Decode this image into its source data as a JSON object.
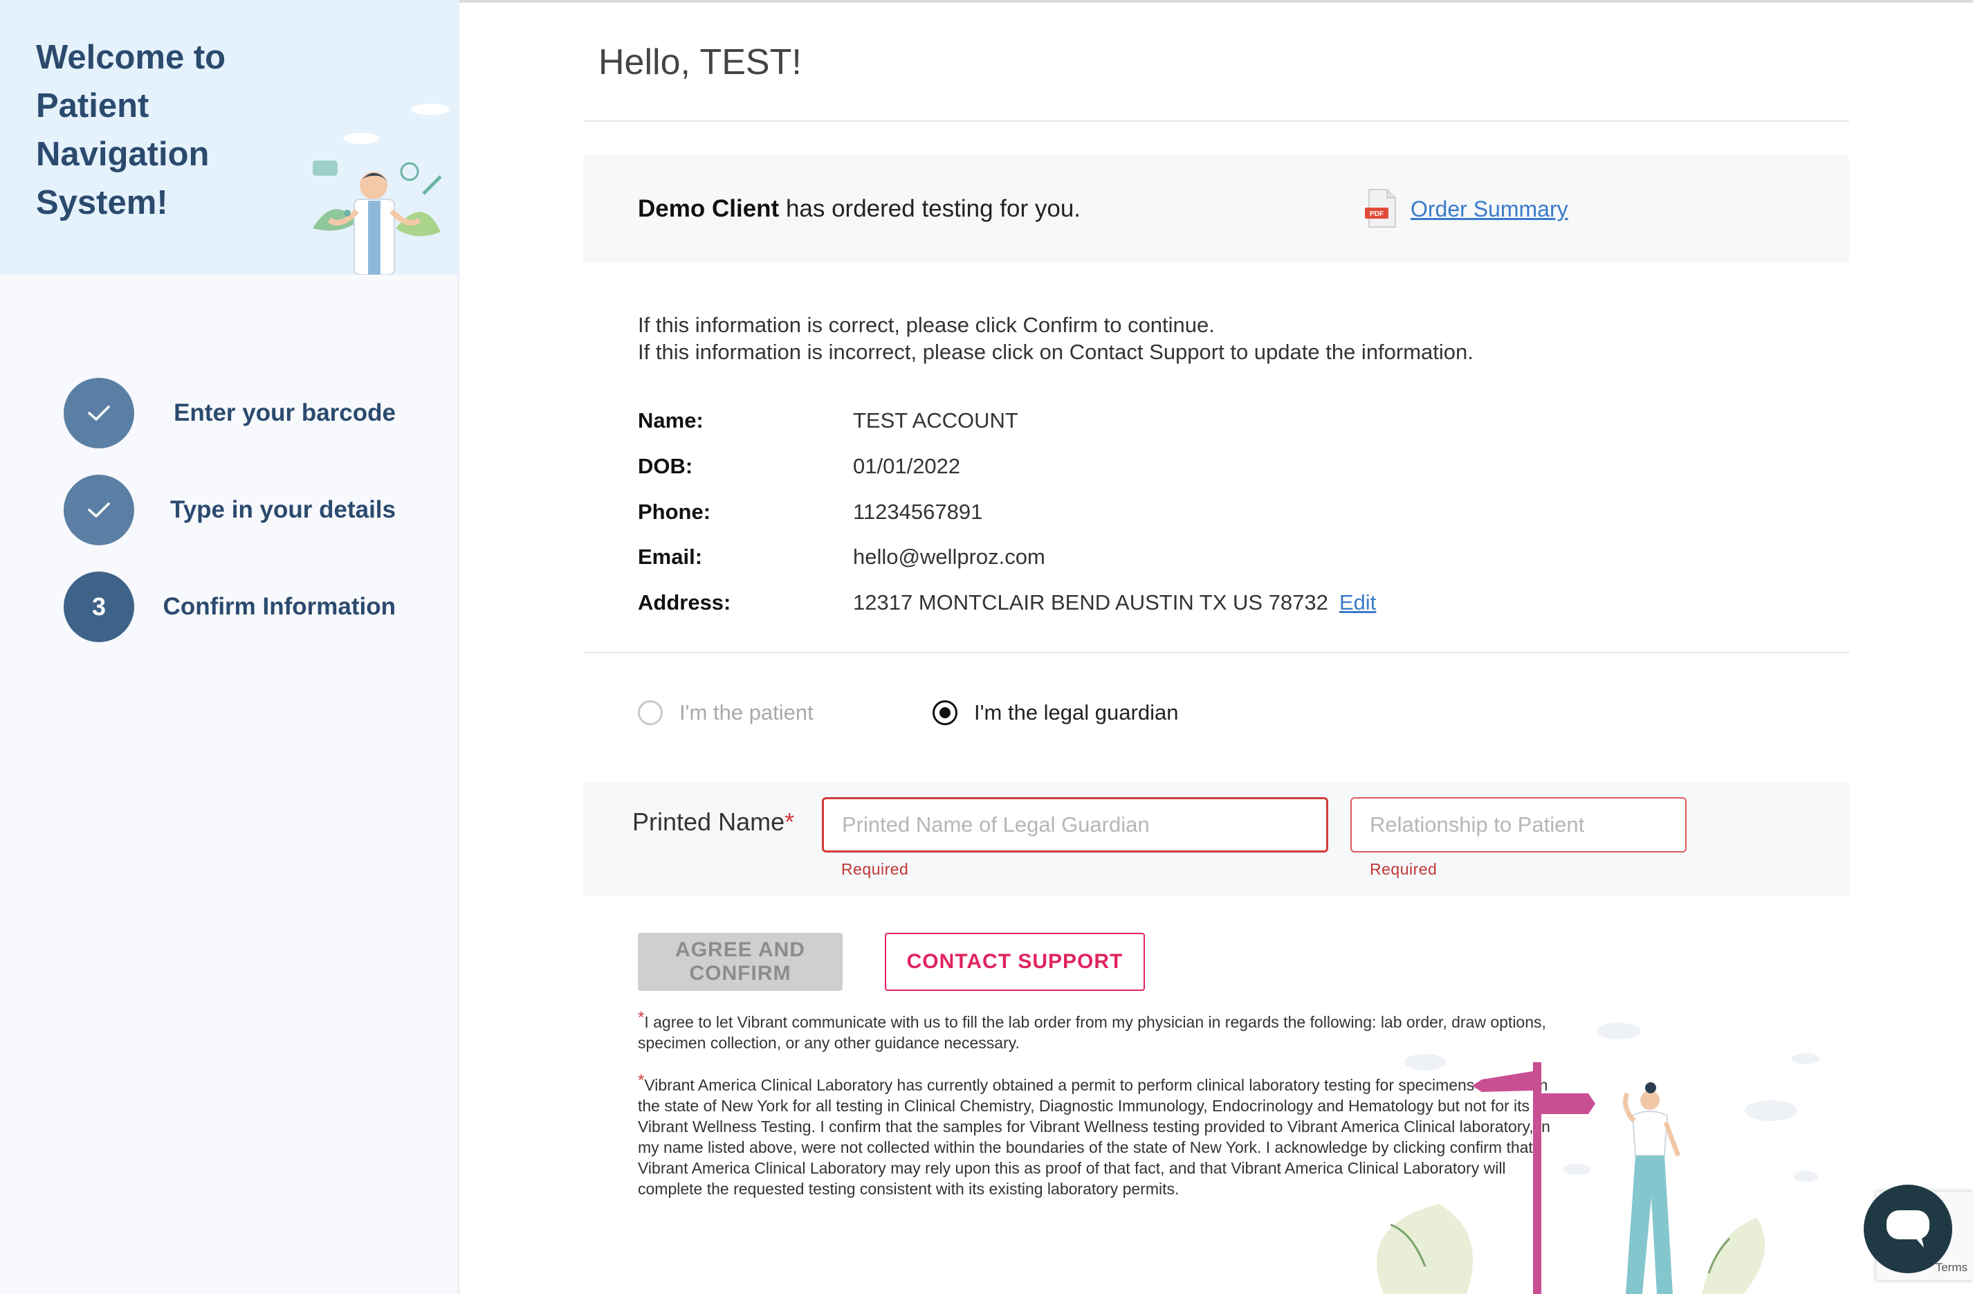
{
  "sidebar": {
    "welcome_title": "Welcome to Patient Navigation System!",
    "steps": [
      {
        "marker": "check",
        "label": "Enter your barcode",
        "status": "complete"
      },
      {
        "marker": "check",
        "label": "Type in your details",
        "status": "complete"
      },
      {
        "marker": "3",
        "label": "Confirm Information",
        "status": "current"
      }
    ]
  },
  "main": {
    "greeting": "Hello, TEST!",
    "order": {
      "client_name": "Demo Client",
      "message": "has ordered testing for you.",
      "link_label": "Order Summary",
      "icon": "pdf-icon"
    },
    "instructions": [
      "If this information is correct, please click Confirm to continue.",
      "If this information is incorrect, please click on Contact Support to update the information."
    ],
    "fields": {
      "name_label": "Name:",
      "name_value": "TEST ACCOUNT",
      "dob_label": "DOB:",
      "dob_value": "01/01/2022",
      "phone_label": "Phone:",
      "phone_value": "11234567891",
      "email_label": "Email:",
      "email_value": "hello@wellproz.com",
      "address_label": "Address:",
      "address_value": "12317 MONTCLAIR BEND AUSTIN TX US 78732",
      "edit_label": "Edit"
    },
    "role": {
      "options": [
        "I'm the patient",
        "I'm the legal guardian"
      ],
      "selected": "I'm the legal guardian"
    },
    "signature": {
      "label": "Printed Name",
      "required_mark": "*",
      "name_placeholder": "Printed Name of Legal Guardian",
      "name_value": "",
      "relationship_placeholder": "Relationship to Patient",
      "relationship_value": "",
      "name_error": "Required",
      "relationship_error": "Required"
    },
    "buttons": {
      "agree": "AGREE AND CONFIRM",
      "support": "CONTACT SUPPORT"
    },
    "disclaimers": [
      {
        "mark": "*",
        "text": "I agree to let Vibrant communicate with us to fill the lab order from my physician in regards the following: lab order, draw options, specimen collection, or any other guidance necessary."
      },
      {
        "mark": "*",
        "text": "Vibrant America Clinical Laboratory has currently obtained a permit to perform clinical laboratory testing for specimens derived in the state of New York for all testing in Clinical Chemistry, Diagnostic Immunology, Endocrinology and Hematology but not for its Vibrant Wellness Testing. I confirm that the samples for Vibrant Wellness testing provided to Vibrant America Clinical laboratory, in my name listed above, were not collected within the boundaries of the state of New York. I acknowledge by clicking confirm that Vibrant America Clinical Laboratory may rely upon this as proof of that fact, and that Vibrant America Clinical Laboratory will complete the requested testing consistent with its existing laboratory permits."
      }
    ]
  },
  "widgets": {
    "recaptcha_text": "Terms",
    "chat_icon": "chat-bubble-icon"
  },
  "colors": {
    "sidebar_title": "#2b4a6e",
    "step_circle": "#5b7fa4",
    "link": "#3a7bc8",
    "error": "#d23a3a",
    "support_accent": "#e0245e",
    "chat_button": "#1f3a44"
  }
}
